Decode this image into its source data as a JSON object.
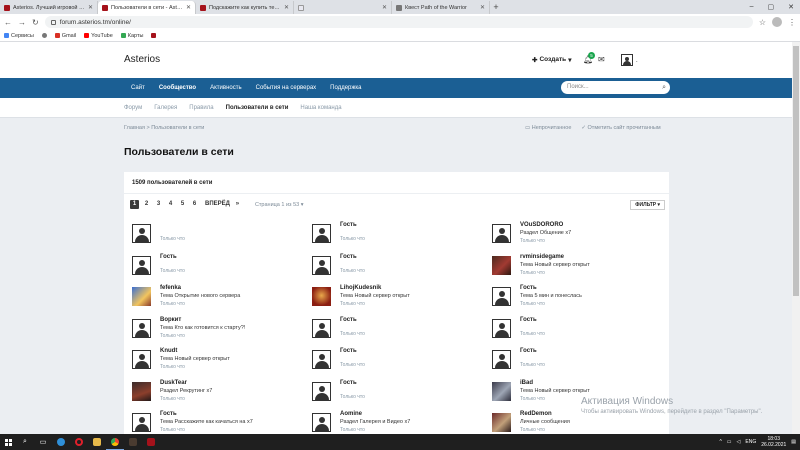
{
  "browser": {
    "tabs": [
      {
        "title": "Asterios. Лучший игровой серв...",
        "active": false
      },
      {
        "title": "Пользователи в сети - Asterios",
        "active": true
      },
      {
        "title": "Подскажите как купить телепо...",
        "active": false
      },
      {
        "title": "",
        "active": false
      },
      {
        "title": "Квест Path of the Warrior",
        "active": false
      }
    ],
    "url": "forum.asterios.tm/online/",
    "bookmarks": [
      "Сервисы",
      "Gmail",
      "YouTube",
      "Карты"
    ]
  },
  "site": {
    "brand": "Asterios",
    "create_label": "Создать",
    "notif_count": "5",
    "user_dot": "."
  },
  "mainnav": [
    "Сайт",
    "Сообщество",
    "Активность",
    "События на серверах",
    "Поддержка"
  ],
  "search": {
    "placeholder": "Поиск..."
  },
  "subnav": [
    "Форум",
    "Галерея",
    "Правила",
    "Пользователи в сети",
    "Наша команда"
  ],
  "breadcrumb": "Главная > Пользователи в сети",
  "crumb_actions": [
    "Непрочитанное",
    "Отметить сайт прочитанным"
  ],
  "page_title": "Пользователи в сети",
  "panel": {
    "count": "1509 пользователей в сети",
    "pages": [
      "1",
      "2",
      "3",
      "4",
      "5",
      "6"
    ],
    "next": "ВПЕРЁД",
    "last": "»",
    "page_info": "Страница 1 из 53",
    "filter": "ФИЛЬТР"
  },
  "users": [
    {
      "name": "",
      "action": "",
      "time": "Только что",
      "avatar": "def"
    },
    {
      "name": "Гость",
      "action": "",
      "time": "Только что",
      "avatar": "def"
    },
    {
      "name": "VOuSDORORO",
      "action": "Раздел Общение x7",
      "time": "Только что",
      "avatar": "def"
    },
    {
      "name": "Гость",
      "action": "",
      "time": "Только что",
      "avatar": "def"
    },
    {
      "name": "Гость",
      "action": "",
      "time": "Только что",
      "avatar": "def"
    },
    {
      "name": "rvminsidegame",
      "action": "Тема Новый сервер открыт",
      "time": "Только что",
      "avatar": "img4"
    },
    {
      "name": "fefenka",
      "action": "Тема Открытие нового сервера",
      "time": "Только что",
      "avatar": "img1"
    },
    {
      "name": "LihojKudesnik",
      "action": "Тема Новый сервер открыт",
      "time": "Только что",
      "avatar": "img2"
    },
    {
      "name": "Гость",
      "action": "Тема 5 мин и понеслась",
      "time": "Только что",
      "avatar": "def"
    },
    {
      "name": "Воркит",
      "action": "Тема Кто как готовится к старту?!",
      "time": "Только что",
      "avatar": "def"
    },
    {
      "name": "Гость",
      "action": "",
      "time": "Только что",
      "avatar": "def"
    },
    {
      "name": "Гость",
      "action": "",
      "time": "Только что",
      "avatar": "def"
    },
    {
      "name": "Knudt",
      "action": "Тема Новый сервер открыт",
      "time": "Только что",
      "avatar": "def"
    },
    {
      "name": "Гость",
      "action": "",
      "time": "Только что",
      "avatar": "def"
    },
    {
      "name": "Гость",
      "action": "",
      "time": "Только что",
      "avatar": "def"
    },
    {
      "name": "DuskTear",
      "action": "Раздел Рекрутинг x7",
      "time": "Только что",
      "avatar": "img3"
    },
    {
      "name": "Гость",
      "action": "",
      "time": "Только что",
      "avatar": "def"
    },
    {
      "name": "iBad",
      "action": "Тема Новый сервер открыт",
      "time": "Только что",
      "avatar": "img5"
    },
    {
      "name": "Гость",
      "action": "Тема Расскажите как качаться на x7",
      "time": "Только что",
      "avatar": "def"
    },
    {
      "name": "Aomine",
      "action": "Раздел Галерея и Видео x7",
      "time": "Только что",
      "avatar": "def"
    },
    {
      "name": "RedDemon",
      "action": "Личные сообщения",
      "time": "Только что",
      "avatar": "img6"
    }
  ],
  "watermark": {
    "line1": "Активация Windows",
    "line2": "Чтобы активировать Windows, перейдите в раздел \"Параметры\"."
  },
  "taskbar": {
    "lang": "ENG",
    "time": "18:03",
    "date": "26.02.2021"
  }
}
